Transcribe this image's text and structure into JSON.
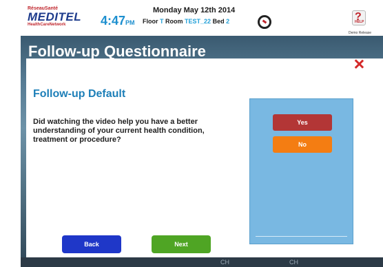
{
  "header": {
    "logo_tag": "RéseauSanté",
    "logo_brand": "MEDITEL",
    "logo_sub": "HealthCareNetwork",
    "time": "4:47",
    "time_suffix": "PM",
    "date": "Monday May 12th 2014",
    "floor_label": "Floor",
    "floor_value": "T",
    "room_label": "Room",
    "room_value": "TEST_22",
    "bed_label": "Bed",
    "bed_value": "2",
    "help_mark": "?",
    "help_label": "HELP",
    "demo_label": "Demo Release"
  },
  "page": {
    "title": "Follow-up Questionnaire"
  },
  "modal": {
    "title": "Follow-up Default",
    "question": "Did watching the video help you have a better understanding of your current health condition, treatment or procedure?",
    "answers": [
      {
        "label": "Yes",
        "color": "#b33636"
      },
      {
        "label": "No",
        "color": "#f47d12"
      }
    ],
    "back_label": "Back",
    "next_label": "Next"
  },
  "background": {
    "strip_left": "CH",
    "strip_right": "CH"
  },
  "colors": {
    "brand": "#1d3b8c",
    "accent": "#1d7fb8",
    "close": "#d42a2a",
    "back_button": "#1f37c8",
    "next_button": "#4fa524",
    "answer_panel": "#79b8e2"
  },
  "icons": [
    "dial-icon",
    "help-icon",
    "close-icon"
  ]
}
